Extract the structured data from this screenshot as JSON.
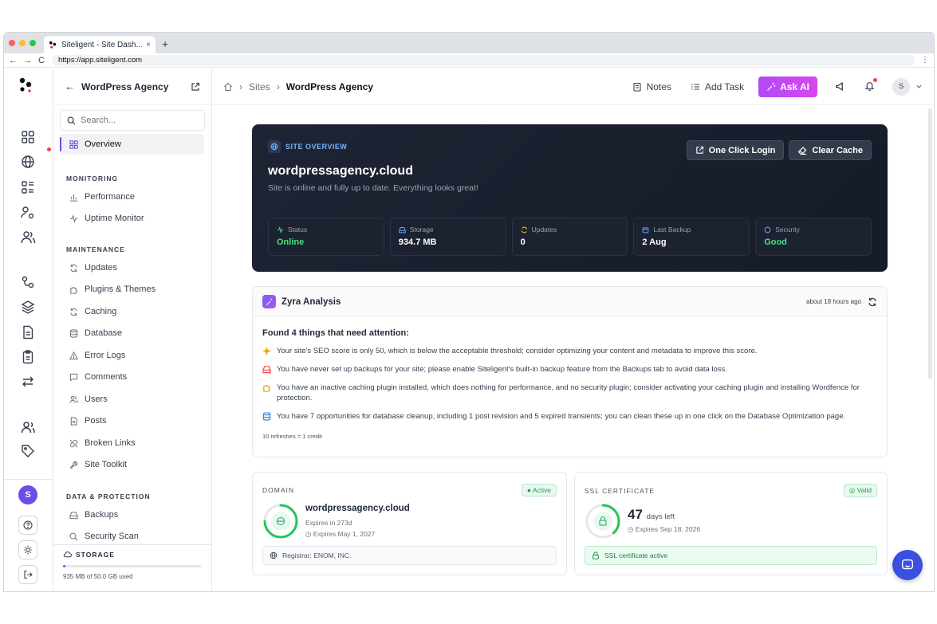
{
  "browser": {
    "tab_title": "Siteligent - Site Dash...",
    "tab_close": "×",
    "new_tab": "+",
    "url": "https://app.siteligent.com",
    "back": "←",
    "forward": "→",
    "reload": "C",
    "menu": "⋮"
  },
  "sidebar": {
    "header_title": "WordPress Agency",
    "search_placeholder": "Search...",
    "overview": "Overview",
    "sections": {
      "monitoring": "MONITORING",
      "maintenance": "MAINTENANCE",
      "data_protection": "DATA & PROTECTION"
    },
    "items": {
      "performance": "Performance",
      "uptime": "Uptime Monitor",
      "updates": "Updates",
      "plugins": "Plugins & Themes",
      "caching": "Caching",
      "database": "Database",
      "error_logs": "Error Logs",
      "comments": "Comments",
      "users": "Users",
      "posts": "Posts",
      "broken_links": "Broken Links",
      "site_toolkit": "Site Toolkit",
      "backups": "Backups",
      "security_scan": "Security Scan"
    },
    "storage": {
      "label": "STORAGE",
      "used_text": "935 MB of 50.0 GB used",
      "used_fraction": 0.0187
    }
  },
  "rail": {
    "avatar_letter": "S"
  },
  "topbar": {
    "crumb_sites": "Sites",
    "crumb_current": "WordPress Agency",
    "notes": "Notes",
    "add_task": "Add Task",
    "ask_ai": "Ask AI",
    "user_letter": "S"
  },
  "hero": {
    "tag": "SITE OVERVIEW",
    "domain": "wordpressagency.cloud",
    "subtitle": "Site is online and fully up to date. Everything looks great!",
    "one_click_login": "One Click Login",
    "clear_cache": "Clear Cache",
    "stats": [
      {
        "label": "Status",
        "value": "Online",
        "color": "#4ade80"
      },
      {
        "label": "Storage",
        "value": "934.7 MB",
        "color": "#ffffff"
      },
      {
        "label": "Updates",
        "value": "0",
        "color": "#ffffff"
      },
      {
        "label": "Last Backup",
        "value": "2 Aug",
        "color": "#ffffff"
      },
      {
        "label": "Security",
        "value": "Good",
        "color": "#4ade80"
      }
    ]
  },
  "zyra": {
    "title": "Zyra Analysis",
    "ago": "about 18 hours ago",
    "found": "Found 4 things that need attention:",
    "findings": [
      "Your site's SEO score is only 50, which is below the acceptable threshold; consider optimizing your content and metadata to improve this score.",
      "You have never set up backups for your site; please enable Siteligent's built-in backup feature from the Backups tab to avoid data loss.",
      "You have an inactive caching plugin installed, which does nothing for performance, and no security plugin; consider activating your caching plugin and installing Wordfence for protection.",
      "You have 7 opportunities for database cleanup, including 1 post revision and 5 expired transients; you can clean these up in one click on the Database Optimization page."
    ],
    "refresh_note": "10 refreshes = 1 credit"
  },
  "domain_card": {
    "title": "DOMAIN",
    "status": "● Active",
    "name": "wordpressagency.cloud",
    "expires_in": "Expires in 273d",
    "expires_on": "Expires May 1, 2027",
    "registrar": "Registrar: ENOM, INC."
  },
  "ssl_card": {
    "title": "SSL CERTIFICATE",
    "status": "Valid",
    "days": "47",
    "days_label": "days left",
    "expires_on": "Expires Sep 18, 2026",
    "note": "SSL certificate active"
  },
  "colors": {
    "accent": "#6d4ce8",
    "success": "#16a34a",
    "hero_bg": "#1a2030",
    "ask_ai": "#c54cf3"
  }
}
